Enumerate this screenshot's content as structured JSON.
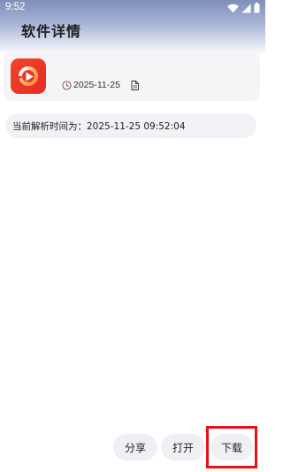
{
  "status_bar": {
    "time": "9:52"
  },
  "header": {
    "title": "软件详情"
  },
  "app": {
    "icon_name": "video-play-app-icon",
    "date": "2025-11-25"
  },
  "parse_info": {
    "text": "当前解析时间为：2025-11-25 09:52:04"
  },
  "actions": {
    "share": "分享",
    "open": "打开",
    "download": "下载"
  },
  "colors": {
    "accent_red": "#e8101a",
    "icon_red": "#f2452b",
    "icon_orange": "#ff8a1e"
  }
}
